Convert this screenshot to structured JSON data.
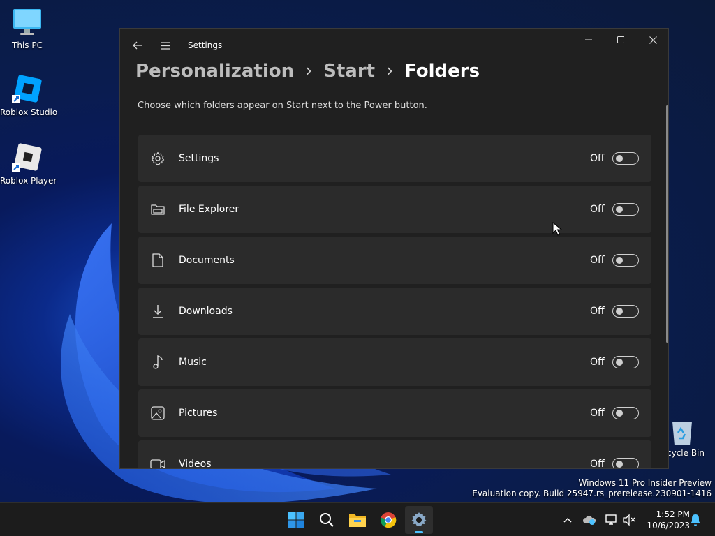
{
  "desktop": {
    "icons": [
      {
        "label": "This PC"
      },
      {
        "label": "Roblox Studio"
      },
      {
        "label": "Roblox Player"
      }
    ],
    "recycle_bin_label": "cycle Bin",
    "watermark_line1": "Windows 11 Pro Insider Preview",
    "watermark_line2": "Evaluation copy. Build 25947.rs_prerelease.230901-1416"
  },
  "window": {
    "title": "Settings",
    "breadcrumb": [
      "Personalization",
      "Start",
      "Folders"
    ],
    "description": "Choose which folders appear on Start next to the Power button.",
    "items": [
      {
        "name": "Settings",
        "state": "Off",
        "icon": "gear-icon"
      },
      {
        "name": "File Explorer",
        "state": "Off",
        "icon": "file-explorer-icon"
      },
      {
        "name": "Documents",
        "state": "Off",
        "icon": "document-icon"
      },
      {
        "name": "Downloads",
        "state": "Off",
        "icon": "download-icon"
      },
      {
        "name": "Music",
        "state": "Off",
        "icon": "music-note-icon"
      },
      {
        "name": "Pictures",
        "state": "Off",
        "icon": "picture-icon"
      },
      {
        "name": "Videos",
        "state": "Off",
        "icon": "video-icon"
      }
    ]
  },
  "taskbar": {
    "apps": [
      "start-icon",
      "search-icon",
      "file-explorer-icon",
      "chrome-icon",
      "settings-icon"
    ],
    "clock_time": "1:52 PM",
    "clock_date": "10/6/2023"
  },
  "colors": {
    "window_bg": "#202020",
    "row_bg": "#2b2b2b",
    "accent": "#4cc2ff",
    "taskbar_bg": "#1c1c1c"
  }
}
